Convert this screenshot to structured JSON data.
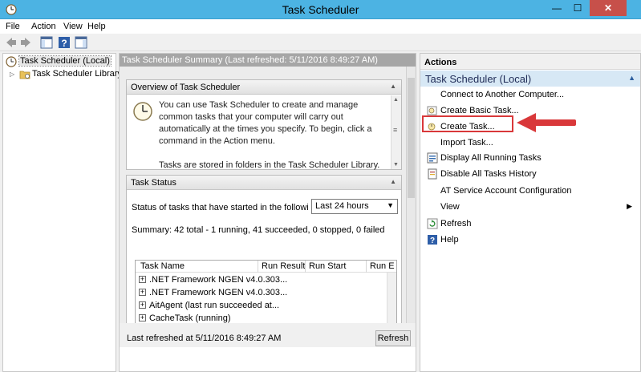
{
  "window": {
    "title": "Task Scheduler",
    "min_glyph": "—",
    "max_glyph": "☐",
    "close_glyph": "✕"
  },
  "menu": {
    "items": [
      "File",
      "Action",
      "View",
      "Help"
    ]
  },
  "tree": {
    "root_label": "Task Scheduler (Local)",
    "child_label": "Task Scheduler Library",
    "expand_glyph": "▷"
  },
  "center": {
    "header": "Task Scheduler Summary (Last refreshed: 5/11/2016 8:49:27 AM)",
    "overview": {
      "title": "Overview of Task Scheduler",
      "para1": "You can use Task Scheduler to create and manage common tasks that your computer will carry out automatically at the times you specify. To begin, click a command in the Action menu.",
      "para2": "Tasks are stored in folders in the Task Scheduler Library. To view or perform an operation on an individual task, select the task in the Task Scheduler Library and click on a command in the Action menu."
    },
    "status": {
      "title": "Task Status",
      "status_line": "Status of tasks that have started in the following ti...",
      "period_selected": "Last 24 hours",
      "summary": "Summary: 42 total - 1 running, 41 succeeded, 0 stopped, 0 failed",
      "columns": [
        "Task Name",
        "Run Result",
        "Run Start",
        "Run E"
      ],
      "rows": [
        ".NET Framework NGEN v4.0.303...",
        ".NET Framework NGEN v4.0.303...",
        "AitAgent (last run succeeded at...",
        "CacheTask (running)"
      ]
    },
    "footer": {
      "last_refreshed": "Last refreshed at 5/11/2016 8:49:27 AM",
      "refresh_label": "Refresh"
    }
  },
  "actions": {
    "title": "Actions",
    "group": "Task Scheduler (Local)",
    "items": [
      {
        "label": "Connect to Another Computer...",
        "icon": "none"
      },
      {
        "label": "Create Basic Task...",
        "icon": "create-basic-task-icon"
      },
      {
        "label": "Create Task...",
        "icon": "create-task-icon"
      },
      {
        "label": "Import Task...",
        "icon": "none"
      },
      {
        "label": "Display All Running Tasks",
        "icon": "running-tasks-icon"
      },
      {
        "label": "Disable All Tasks History",
        "icon": "history-icon"
      },
      {
        "label": "AT Service Account Configuration",
        "icon": "none"
      },
      {
        "label": "View",
        "icon": "none"
      },
      {
        "label": "Refresh",
        "icon": "refresh-icon"
      },
      {
        "label": "Help",
        "icon": "help-icon"
      }
    ]
  },
  "annotation": {
    "highlight_color": "#d9383a"
  }
}
